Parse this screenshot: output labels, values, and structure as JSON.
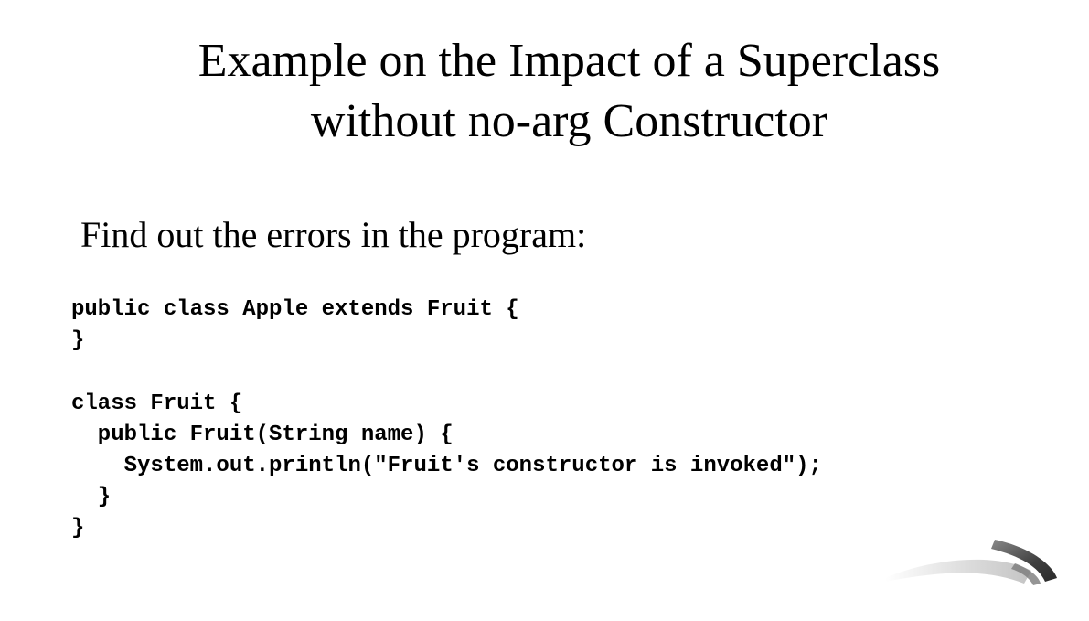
{
  "slide": {
    "title_lines": [
      "Example on the Impact of a Superclass",
      "without no-arg Constructor"
    ],
    "prompt": "Find out the errors in the program:",
    "code_lines": [
      "public class Apple extends Fruit {",
      "}",
      "",
      "class Fruit {",
      "  public Fruit(String name) {",
      "    System.out.println(\"Fruit's constructor is invoked\");",
      "  }",
      "}"
    ],
    "colors": {
      "text": "#000000",
      "background": "#ffffff",
      "logo_dark": "#4a4a4a",
      "logo_light": "#e6e6e6"
    },
    "logo_icon": "swirl-logo-icon"
  }
}
